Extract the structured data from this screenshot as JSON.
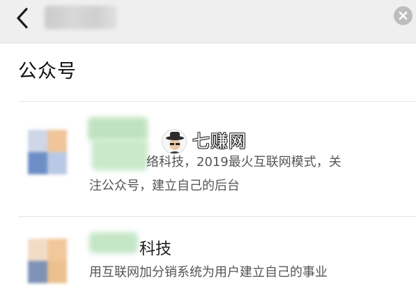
{
  "header": {
    "back_icon": "chevron-left-icon",
    "search_query": "",
    "clear_icon": "close-circle-icon"
  },
  "section": {
    "title": "公众号"
  },
  "results": [
    {
      "name_visible_suffix": "",
      "description_line1": "络科技，2019最火互联网模式，关",
      "description_line2": "注公众号，建立自己的后台"
    },
    {
      "name_visible_suffix": "科技",
      "description_line1": "用互联网加分销系统为用户建立自己的事业"
    }
  ],
  "watermark": {
    "text": "七赚网"
  },
  "colors": {
    "topbar_bg": "#efefef",
    "clear_button": "#bdbdbd",
    "divider": "#e6e6e6",
    "description_text": "#555555",
    "title_text": "#111111"
  }
}
